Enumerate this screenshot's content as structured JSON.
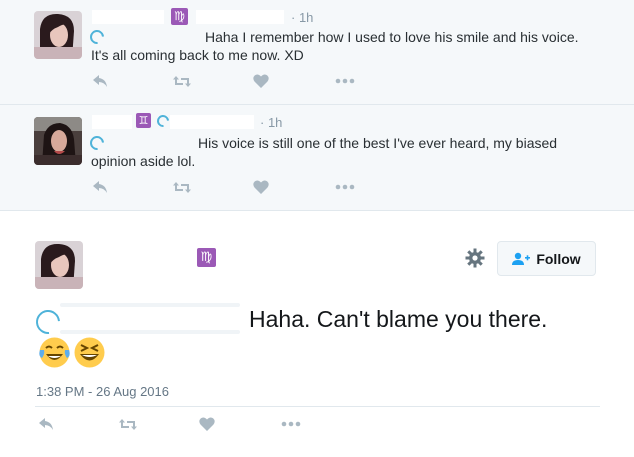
{
  "replies": [
    {
      "time": "1h",
      "zodiac": "♍",
      "text": "Haha I remember how I used to love his smile and his voice. It's all coming back to me now. XD"
    },
    {
      "time": "1h",
      "zodiac": "♊",
      "text": "His voice is still one of the best I've ever heard, my biased opinion aside lol."
    }
  ],
  "main_tweet": {
    "zodiac": "♍",
    "text": "Haha. Can't blame you there.",
    "emojis": [
      "face-with-tears-of-joy",
      "grinning-squinting-face"
    ],
    "timestamp": "1:38 PM - 26 Aug 2016",
    "follow_label": "Follow"
  },
  "icons": {
    "reply": "reply-icon",
    "retweet": "retweet-icon",
    "like": "heart-icon",
    "more": "more-icon",
    "settings": "gear-icon",
    "follow": "add-user-icon"
  },
  "colors": {
    "zodiac_bg": "#9b59b6",
    "action_icon": "#aab8c2",
    "reply_bg": "#f5f8fa",
    "text": "#292f33",
    "muted": "#8899a6"
  }
}
